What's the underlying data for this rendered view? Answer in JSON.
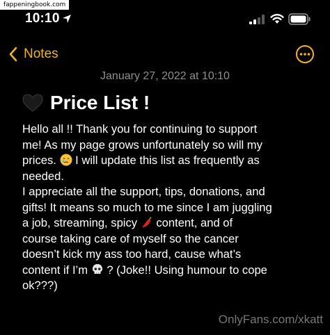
{
  "watermark_top": "fappeningbook.com",
  "watermark_bottom": "OnlyFans.com/xkatt",
  "status_bar": {
    "time": "10:10",
    "icons": [
      "location-arrow-icon",
      "cellular-signal-icon",
      "wifi-icon",
      "battery-icon"
    ]
  },
  "nav": {
    "back_label": "Notes",
    "more_icon": "ellipsis-circle-icon",
    "accent_color": "#f4b41a"
  },
  "note": {
    "date": "January 27, 2022 at 10:10",
    "title_icon": "black-heart-icon",
    "title": "Price List !",
    "lines": [
      "Hello all !! Thank you for continuing to support",
      "me! As my page grows unfortunately so will my",
      "prices.",
      "I will update this list as frequently as",
      "needed.",
      "I appreciate all the support, tips, donations, and",
      "gifts! It means so much to me since I am juggling",
      "a job, streaming, spicy",
      "content, and of",
      "course taking care of myself so the cancer",
      "doesn’t kick my ass too hard, cause what’s",
      "content if I’m",
      "? (Joke!! Using humour to cope",
      "ok???)"
    ]
  }
}
